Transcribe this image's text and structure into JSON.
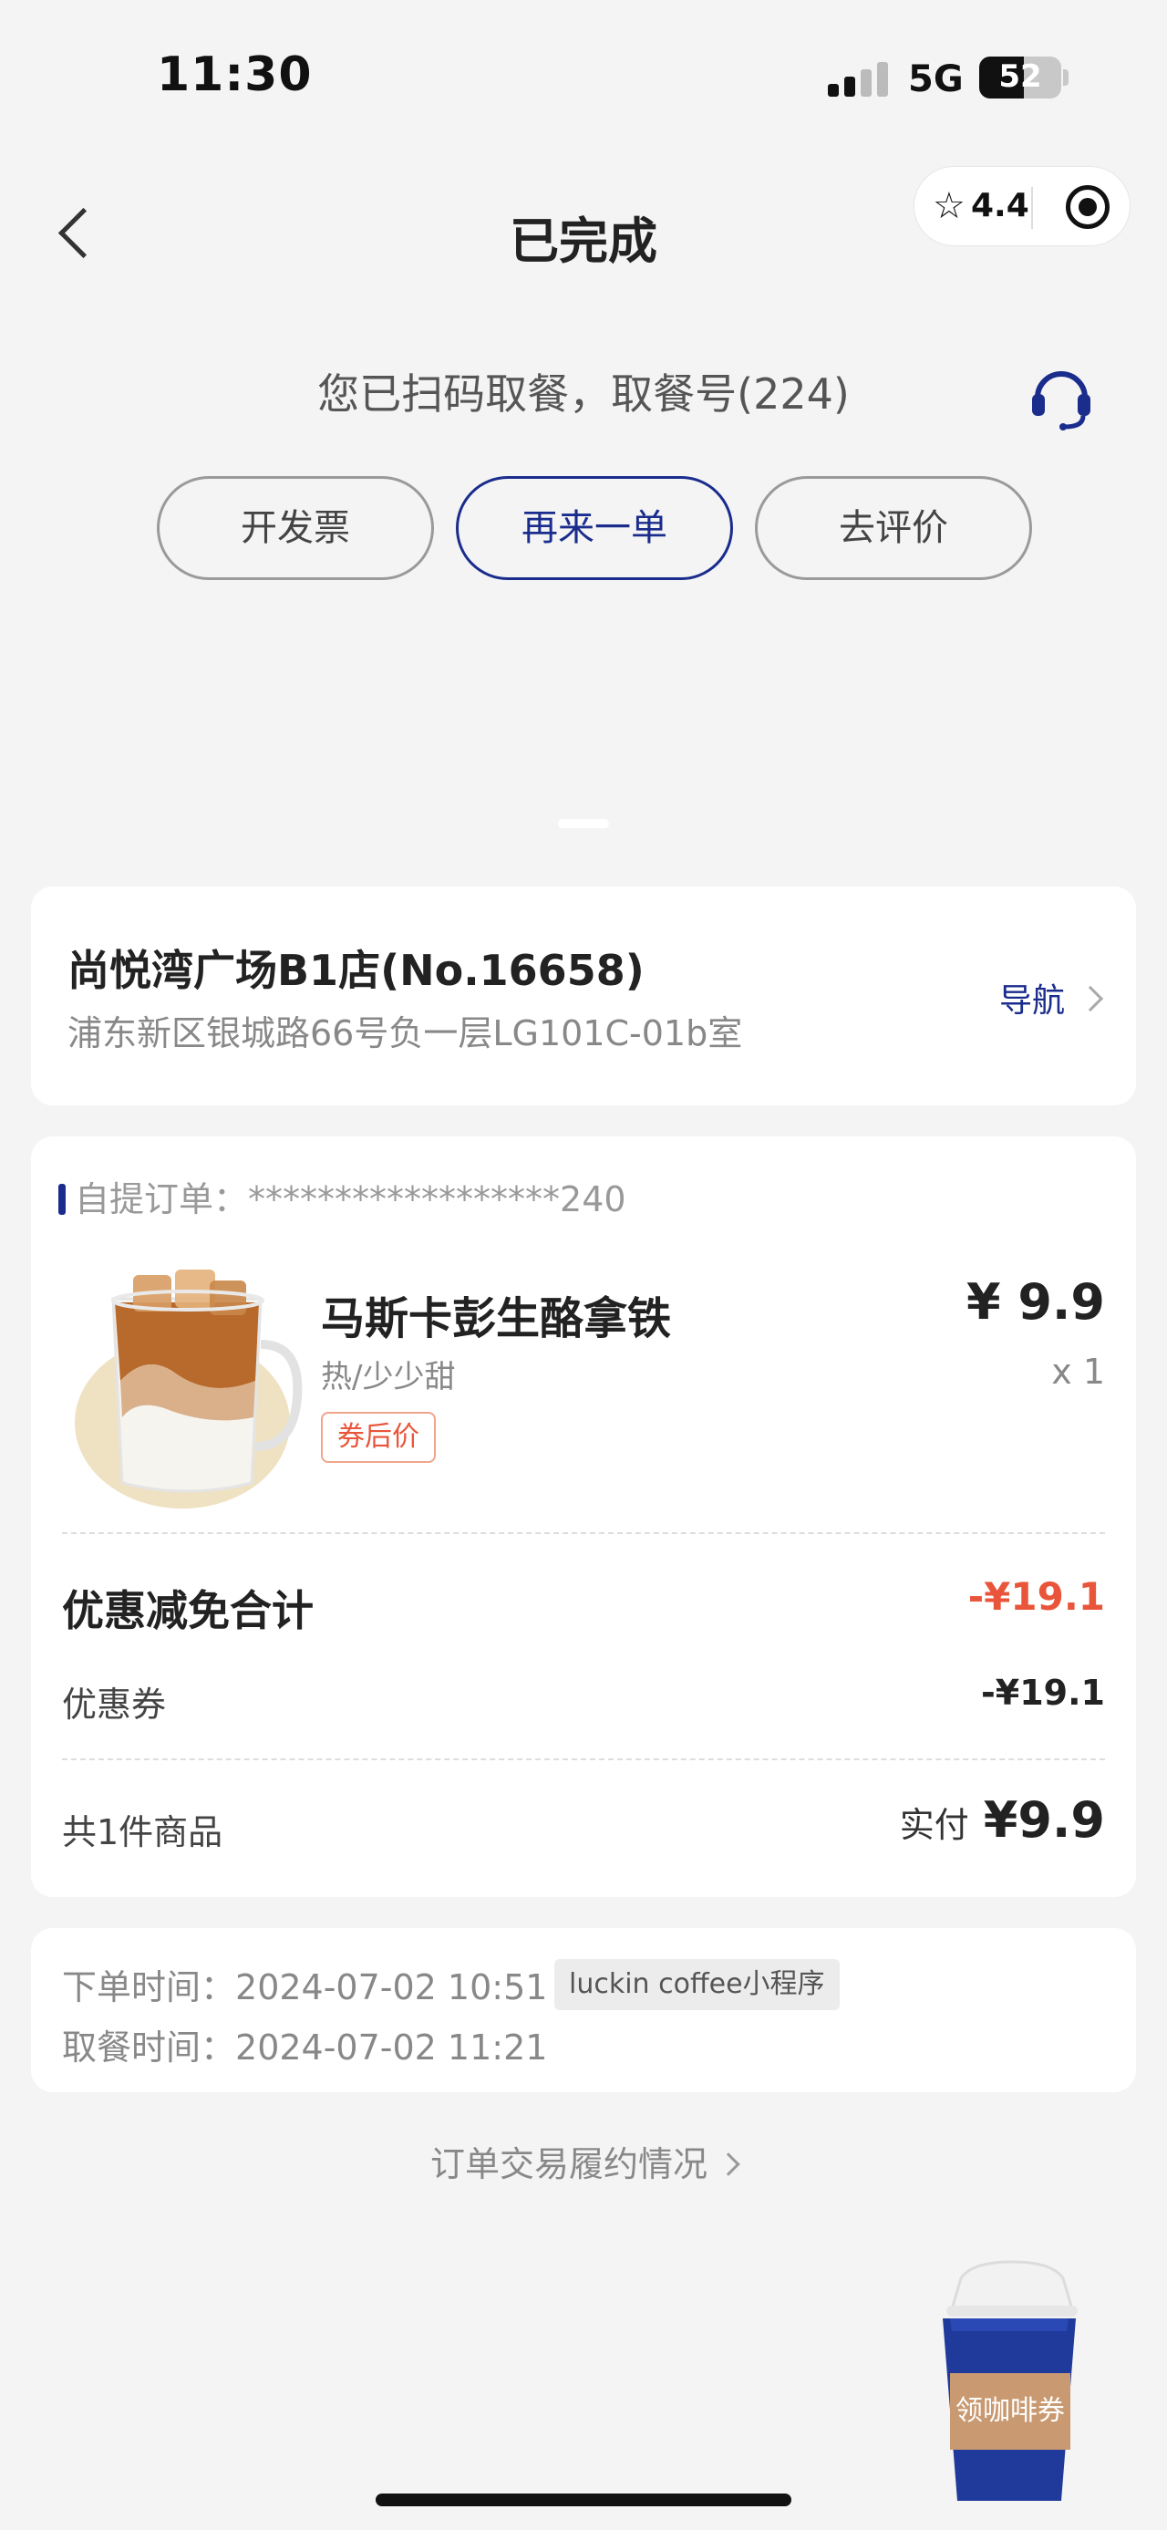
{
  "status_bar": {
    "time": "11:30",
    "network": "5G",
    "battery": "52"
  },
  "nav": {
    "title": "已完成",
    "rating": "4.4"
  },
  "pickup": {
    "message": "您已扫码取餐，取餐号(224)"
  },
  "actions": {
    "invoice": "开发票",
    "reorder": "再来一单",
    "review": "去评价"
  },
  "store": {
    "name": "尚悦湾广场B1店(No.16658)",
    "address": "浦东新区银城路66号负一层LG101C-01b室",
    "navigate_label": "导航"
  },
  "order": {
    "label": "自提订单：",
    "number": "******************240",
    "item": {
      "name": "马斯卡彭生酪拿铁",
      "spec": "热/少少甜",
      "tag": "券后价",
      "price": "¥ 9.9",
      "quantity": "x 1"
    },
    "discount_total_label": "优惠减免合计",
    "discount_total_value": "-¥19.1",
    "coupon_label": "优惠券",
    "coupon_value": "-¥19.1",
    "items_count": "共1件商品",
    "paid_label": "实付",
    "paid_amount": "¥9.9"
  },
  "times": {
    "order_time_label": "下单时间：",
    "order_time": "2024-07-02 10:51",
    "source": "luckin coffee小程序",
    "pickup_time_label": "取餐时间：",
    "pickup_time": "2024-07-02 11:21"
  },
  "fulfillment_link": "订单交易履约情况",
  "float_coupon": "领咖啡券",
  "colors": {
    "brand": "#1a2c8c",
    "discount": "#e9553a",
    "background": "#f4f4f5"
  }
}
